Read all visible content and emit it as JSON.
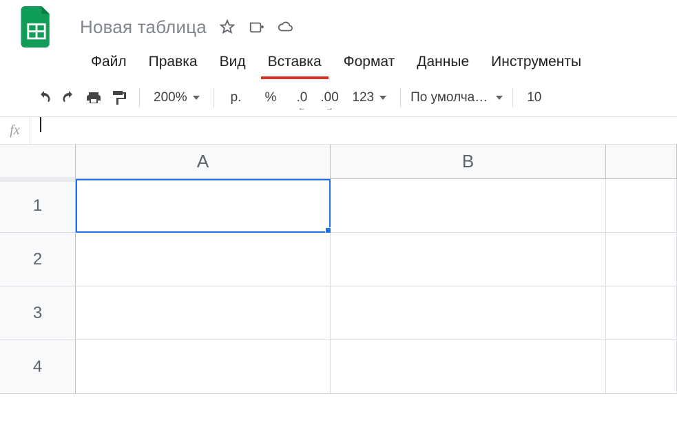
{
  "doc": {
    "title": "Новая таблица"
  },
  "menu": {
    "items": [
      {
        "label": "Файл"
      },
      {
        "label": "Правка"
      },
      {
        "label": "Вид"
      },
      {
        "label": "Вставка",
        "active": true
      },
      {
        "label": "Формат"
      },
      {
        "label": "Данные"
      },
      {
        "label": "Инструменты"
      }
    ]
  },
  "toolbar": {
    "zoom": "200%",
    "currency_symbol": "р.",
    "percent_symbol": "%",
    "dec_decrease": ".0",
    "dec_increase": ".00",
    "num_format": "123",
    "font_name": "По умолча…",
    "font_size": "10"
  },
  "formula_bar": {
    "fx_label": "fx",
    "value": ""
  },
  "grid": {
    "columns": [
      "A",
      "B"
    ],
    "rows": [
      "1",
      "2",
      "3",
      "4"
    ],
    "selected_cell": "A1"
  }
}
